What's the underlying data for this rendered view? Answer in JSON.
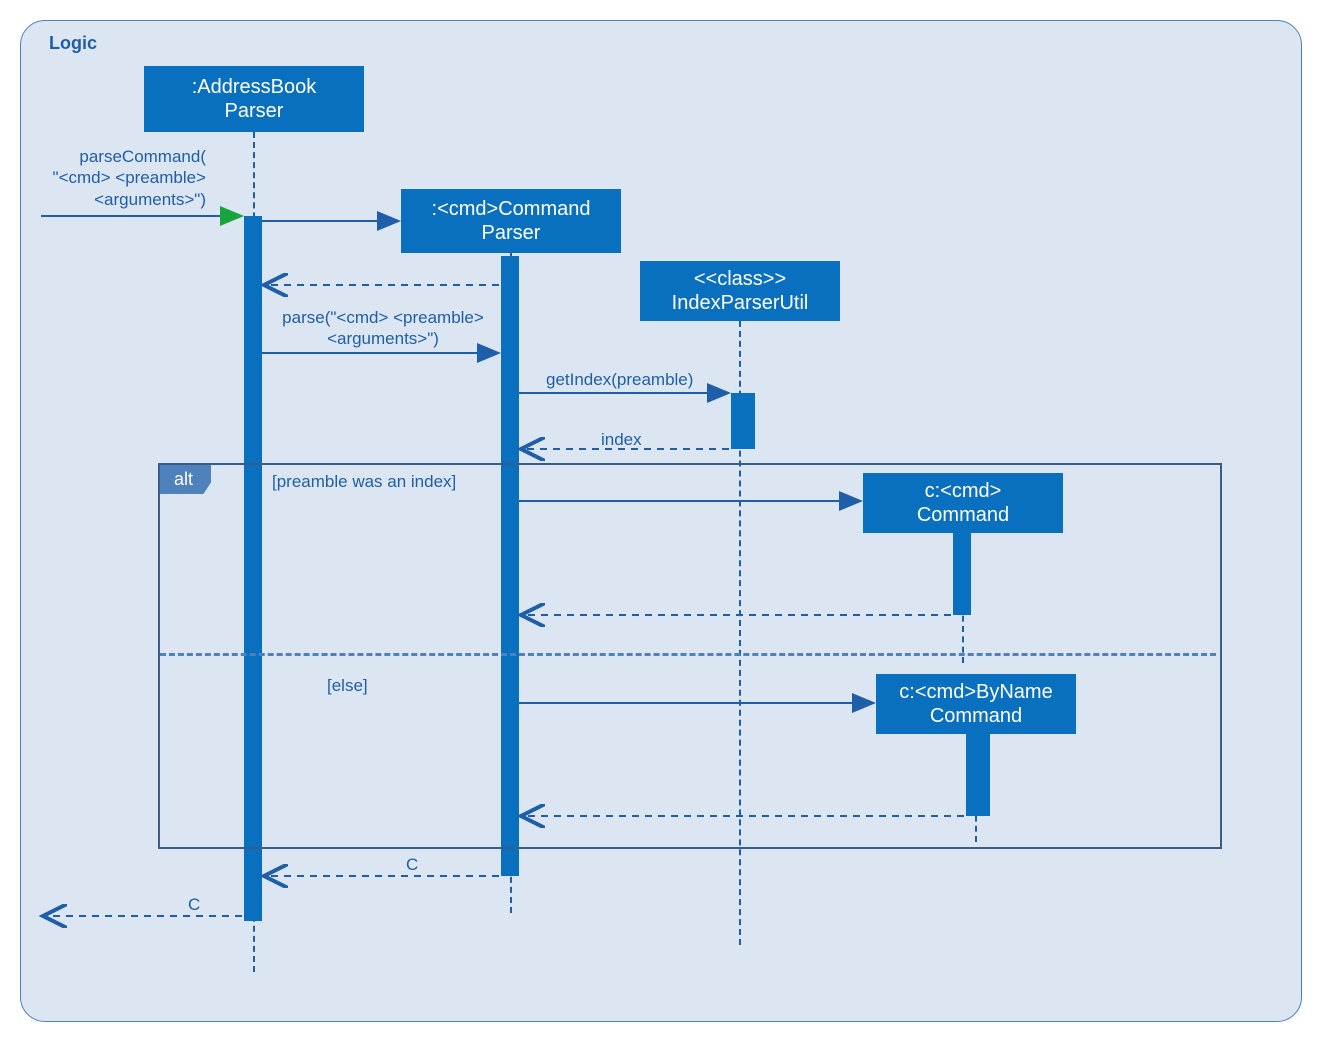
{
  "frame_label": "Logic",
  "participants": {
    "address_book_parser": ":AddressBook\nParser",
    "cmd_command_parser": ":<cmd>Command\nParser",
    "index_parser_util": "<<class>>\nIndexParserUtil",
    "cmd_command": "c:<cmd>\nCommand",
    "cmd_by_name_command": "c:<cmd>ByName\nCommand"
  },
  "messages": {
    "parse_command": "parseCommand(\n\"<cmd> <preamble>\n<arguments>\")",
    "parse": "parse(\"<cmd> <preamble>\n<arguments>\")",
    "get_index": "getIndex(preamble)",
    "index_return": "index",
    "guard_index": "[preamble was an index]",
    "guard_else": "[else]",
    "return_c1": "C",
    "return_c2": "C"
  },
  "alt_label": "alt"
}
